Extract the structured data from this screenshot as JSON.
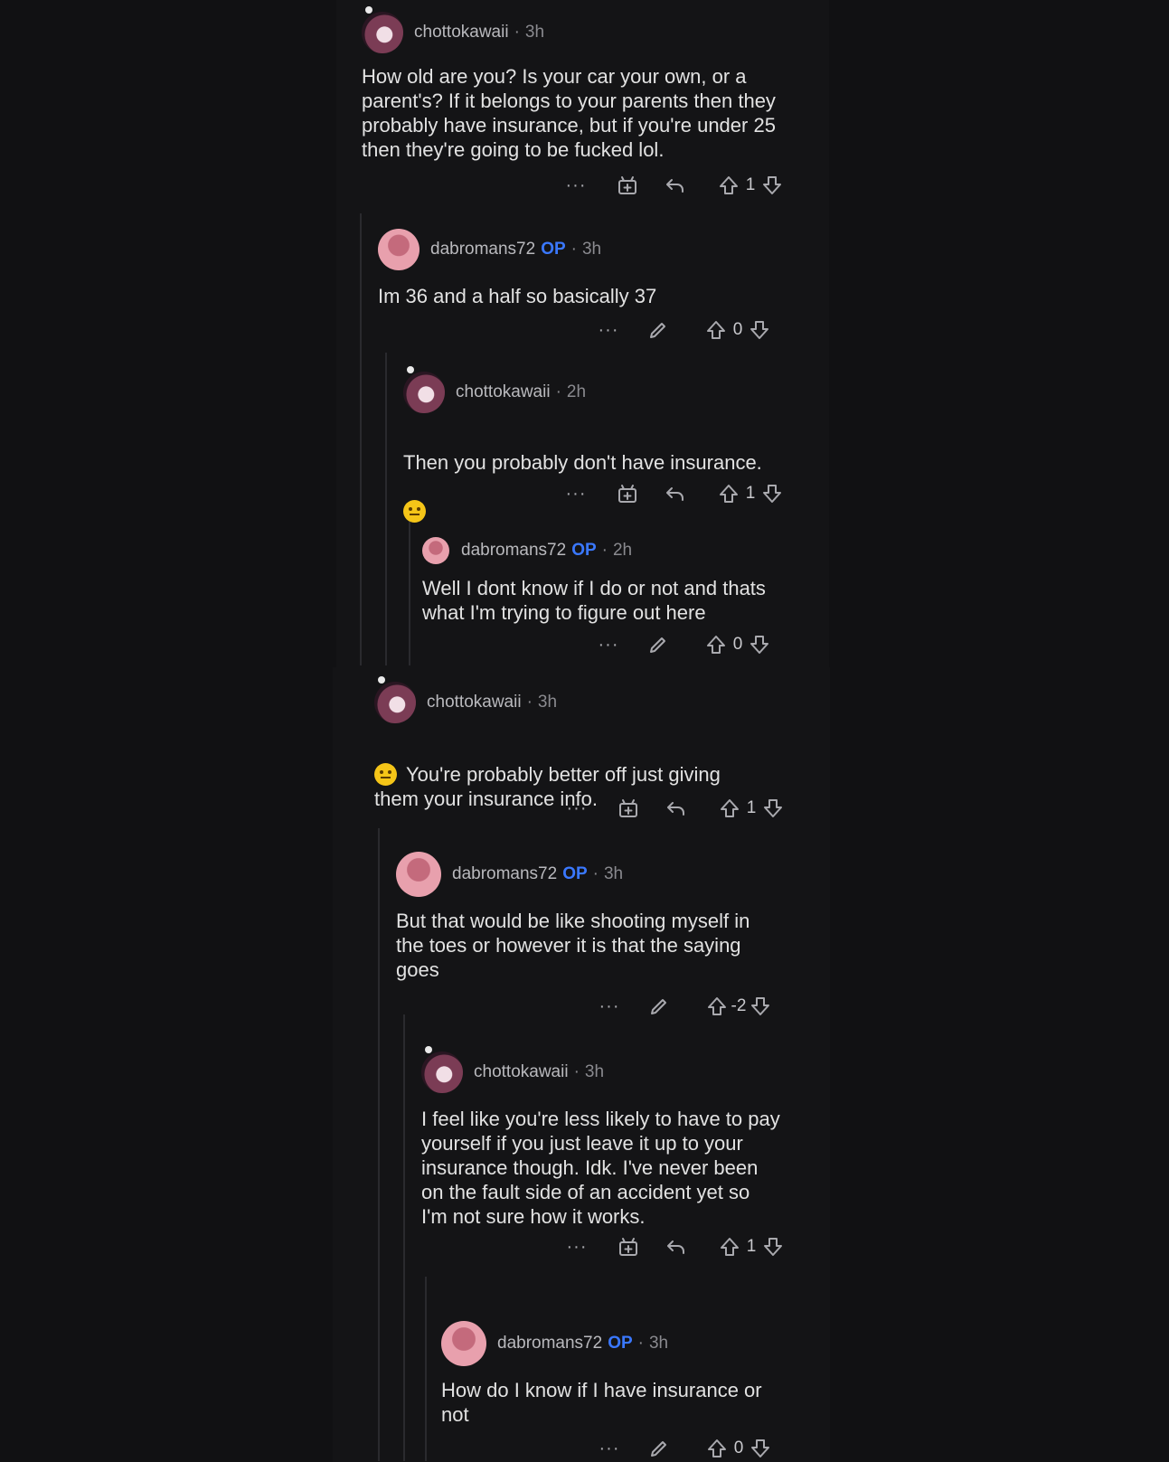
{
  "comments": [
    {
      "username": "chottokawaii",
      "op": "",
      "time": "3h",
      "text": "How old are you? Is your car your own, or a\nparent's? If it belongs to your parents then they\nprobably have insurance, but if you're under 25\nthen they're going to be fucked lol.",
      "score": "1",
      "avatar": "anime",
      "icons": [
        "more-icon",
        "award-icon",
        "reply-icon",
        "upvote-icon",
        "downvote-icon"
      ]
    },
    {
      "username": "dabromans72",
      "op": "OP",
      "time": "3h",
      "text": "Im 36 and a half so basically 37",
      "score": "0",
      "avatar": "pink",
      "icons": [
        "more-icon",
        "edit-icon",
        "upvote-icon",
        "downvote-icon"
      ]
    },
    {
      "username": "chottokawaii",
      "op": "",
      "time": "2h",
      "text": "Then you probably don't have insurance.",
      "score": "1",
      "avatar": "anime",
      "emoji": "grinning-emoji",
      "icons": [
        "more-icon",
        "award-icon",
        "reply-icon",
        "upvote-icon",
        "downvote-icon"
      ]
    },
    {
      "username": "dabromans72",
      "op": "OP",
      "time": "2h",
      "text": "Well I dont know if I do or not and thats\nwhat I'm trying to figure out here",
      "score": "0",
      "avatar": "pink",
      "icons": [
        "more-icon",
        "edit-icon",
        "upvote-icon",
        "downvote-icon"
      ]
    },
    {
      "username": "chottokawaii",
      "op": "",
      "time": "3h",
      "text": "You're probably better off just giving\nthem your insurance info.",
      "score": "1",
      "avatar": "anime",
      "emoji": "neutral-face-emoji",
      "icons": [
        "more-icon",
        "award-icon",
        "reply-icon",
        "upvote-icon",
        "downvote-icon"
      ]
    },
    {
      "username": "dabromans72",
      "op": "OP",
      "time": "3h",
      "text": "But that would be like shooting myself in\nthe toes or however it is that the saying\ngoes",
      "score": "-2",
      "avatar": "pink",
      "icons": [
        "more-icon",
        "edit-icon",
        "upvote-icon",
        "downvote-icon"
      ]
    },
    {
      "username": "chottokawaii",
      "op": "",
      "time": "3h",
      "text": "I feel like you're less likely to have to pay\nyourself if you just leave it up to your\ninsurance though. Idk. I've never been\non the fault side of an accident yet so\nI'm not sure how it works.",
      "score": "1",
      "avatar": "anime",
      "icons": [
        "more-icon",
        "award-icon",
        "reply-icon",
        "upvote-icon",
        "downvote-icon"
      ]
    },
    {
      "username": "dabromans72",
      "op": "OP",
      "time": "3h",
      "text": "How do I know if I have insurance or\nnot",
      "score": "0",
      "avatar": "pink",
      "icons": [
        "more-icon",
        "edit-icon",
        "upvote-icon",
        "downvote-icon"
      ]
    }
  ],
  "separator": "·",
  "more_label": "···"
}
